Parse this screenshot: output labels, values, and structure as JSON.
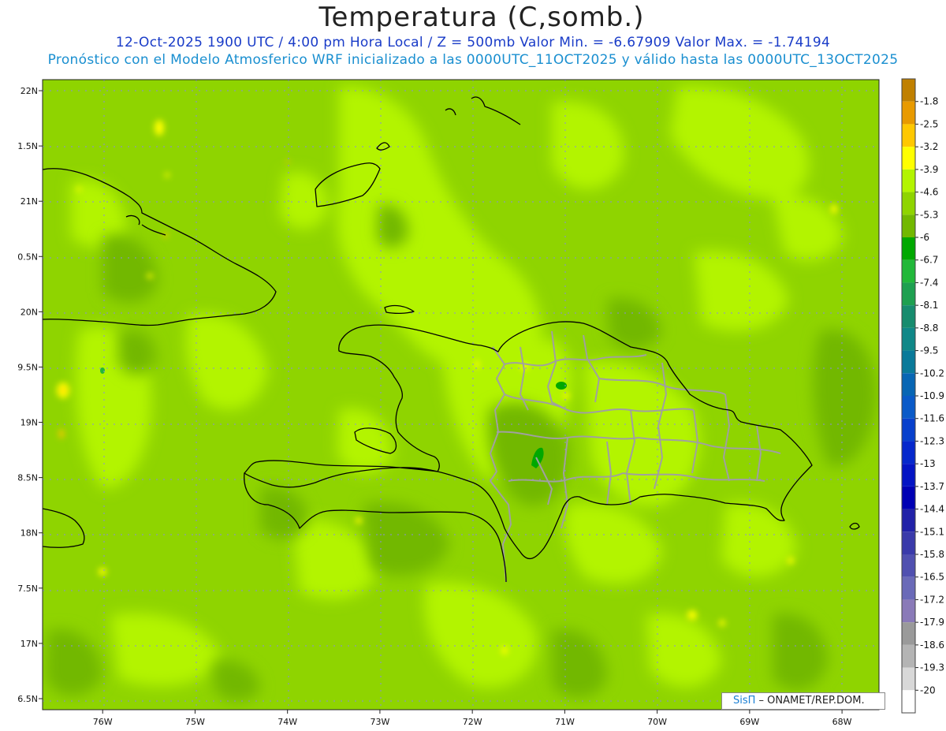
{
  "header": {
    "title": "Temperatura (C,somb.)",
    "subtitle_1": "12-Oct-2025  1900 UTC / 4:00 pm Hora Local / Z = 500mb  Valor Min. = -6.67909  Valor Max. = -1.74194",
    "subtitle_2": "Pronóstico con el Modelo Atmosferico WRF inicializado a las 0000UTC_11OCT2025 y válido hasta las  0000UTC_13OCT2025"
  },
  "credit": {
    "system": "SisΠ",
    "org": " – ONAMET/REP.DOM."
  },
  "colors": {
    "base_field": "#8fd400",
    "light_field": "#b3f400",
    "dark_field": "#72b800",
    "coast": "#000000",
    "borders": "#a0a0a0",
    "gridline": "#8a8ae0"
  },
  "map": {
    "lon_range": [
      -76.65,
      -67.6
    ],
    "lat_range": [
      16.4,
      22.1
    ],
    "lon_ticks": [
      {
        "value": -76,
        "label": "76W"
      },
      {
        "value": -75,
        "label": "75W"
      },
      {
        "value": -74,
        "label": "74W"
      },
      {
        "value": -73,
        "label": "73W"
      },
      {
        "value": -72,
        "label": "72W"
      },
      {
        "value": -71,
        "label": "71W"
      },
      {
        "value": -70,
        "label": "70W"
      },
      {
        "value": -69,
        "label": "69W"
      },
      {
        "value": -68,
        "label": "68W"
      }
    ],
    "lat_ticks": [
      {
        "value": 22,
        "label": "22N"
      },
      {
        "value": 21.5,
        "label": "1.5N"
      },
      {
        "value": 21,
        "label": "21N"
      },
      {
        "value": 20.5,
        "label": "0.5N"
      },
      {
        "value": 20,
        "label": "20N"
      },
      {
        "value": 19.5,
        "label": "9.5N"
      },
      {
        "value": 19,
        "label": "19N"
      },
      {
        "value": 18.5,
        "label": "8.5N"
      },
      {
        "value": 18,
        "label": "18N"
      },
      {
        "value": 17.5,
        "label": "7.5N"
      },
      {
        "value": 17,
        "label": "17N"
      },
      {
        "value": 16.5,
        "label": "6.5N"
      }
    ]
  },
  "legend": {
    "items": [
      {
        "label": "-1.8",
        "color": "#c08000"
      },
      {
        "label": "-2.5",
        "color": "#e89a00"
      },
      {
        "label": "-3.2",
        "color": "#ffc800"
      },
      {
        "label": "-3.9",
        "color": "#ffff00"
      },
      {
        "label": "-4.6",
        "color": "#b3f400"
      },
      {
        "label": "-5.3",
        "color": "#8fd400"
      },
      {
        "label": "-6",
        "color": "#72b800"
      },
      {
        "label": "-6.7",
        "color": "#00a800"
      },
      {
        "label": "-7.4",
        "color": "#22b83a"
      },
      {
        "label": "-8.1",
        "color": "#1ea050"
      },
      {
        "label": "-8.8",
        "color": "#178c6e"
      },
      {
        "label": "-9.5",
        "color": "#108888"
      },
      {
        "label": "-10.2",
        "color": "#0a7a9a"
      },
      {
        "label": "-10.9",
        "color": "#0866b4"
      },
      {
        "label": "-11.6",
        "color": "#0a5ac8"
      },
      {
        "label": "-12.3",
        "color": "#0840cc"
      },
      {
        "label": "-13",
        "color": "#0628cc"
      },
      {
        "label": "-13.7",
        "color": "#0414c4"
      },
      {
        "label": "-14.4",
        "color": "#0000b4"
      },
      {
        "label": "-15.1",
        "color": "#2222a8"
      },
      {
        "label": "-15.8",
        "color": "#3a3aaa"
      },
      {
        "label": "-16.5",
        "color": "#5050b0"
      },
      {
        "label": "-17.2",
        "color": "#6a6ab8"
      },
      {
        "label": "-17.9",
        "color": "#8a7ab8"
      },
      {
        "label": "-18.6",
        "color": "#9a9a9a"
      },
      {
        "label": "-19.3",
        "color": "#b4b4b4"
      },
      {
        "label": "-20",
        "color": "#d8d8d8"
      },
      {
        "label": "",
        "color": "#ffffff"
      }
    ]
  }
}
